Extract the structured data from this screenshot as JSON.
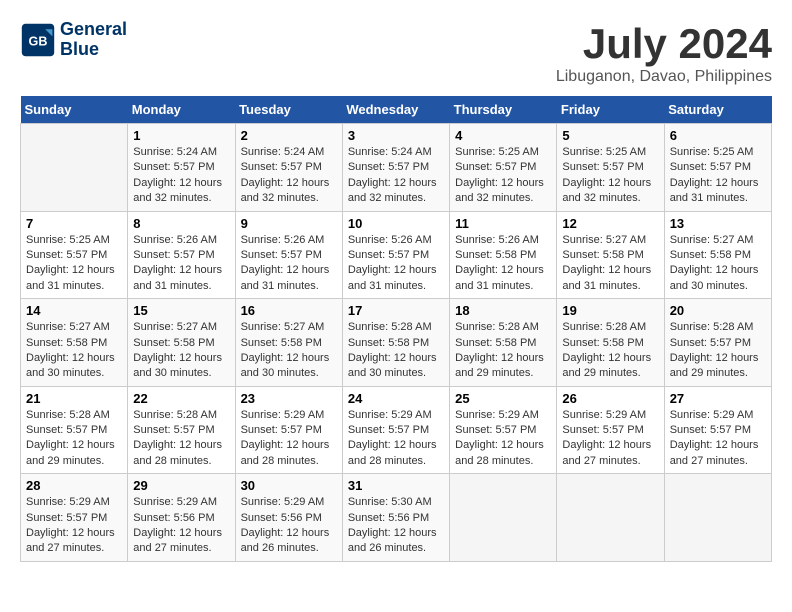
{
  "logo": {
    "line1": "General",
    "line2": "Blue"
  },
  "title": "July 2024",
  "subtitle": "Libuganon, Davao, Philippines",
  "header": {
    "days": [
      "Sunday",
      "Monday",
      "Tuesday",
      "Wednesday",
      "Thursday",
      "Friday",
      "Saturday"
    ]
  },
  "weeks": [
    {
      "cells": [
        {
          "day": "",
          "info": ""
        },
        {
          "day": "1",
          "info": "Sunrise: 5:24 AM\nSunset: 5:57 PM\nDaylight: 12 hours\nand 32 minutes."
        },
        {
          "day": "2",
          "info": "Sunrise: 5:24 AM\nSunset: 5:57 PM\nDaylight: 12 hours\nand 32 minutes."
        },
        {
          "day": "3",
          "info": "Sunrise: 5:24 AM\nSunset: 5:57 PM\nDaylight: 12 hours\nand 32 minutes."
        },
        {
          "day": "4",
          "info": "Sunrise: 5:25 AM\nSunset: 5:57 PM\nDaylight: 12 hours\nand 32 minutes."
        },
        {
          "day": "5",
          "info": "Sunrise: 5:25 AM\nSunset: 5:57 PM\nDaylight: 12 hours\nand 32 minutes."
        },
        {
          "day": "6",
          "info": "Sunrise: 5:25 AM\nSunset: 5:57 PM\nDaylight: 12 hours\nand 31 minutes."
        }
      ]
    },
    {
      "cells": [
        {
          "day": "7",
          "info": "Sunrise: 5:25 AM\nSunset: 5:57 PM\nDaylight: 12 hours\nand 31 minutes."
        },
        {
          "day": "8",
          "info": "Sunrise: 5:26 AM\nSunset: 5:57 PM\nDaylight: 12 hours\nand 31 minutes."
        },
        {
          "day": "9",
          "info": "Sunrise: 5:26 AM\nSunset: 5:57 PM\nDaylight: 12 hours\nand 31 minutes."
        },
        {
          "day": "10",
          "info": "Sunrise: 5:26 AM\nSunset: 5:57 PM\nDaylight: 12 hours\nand 31 minutes."
        },
        {
          "day": "11",
          "info": "Sunrise: 5:26 AM\nSunset: 5:58 PM\nDaylight: 12 hours\nand 31 minutes."
        },
        {
          "day": "12",
          "info": "Sunrise: 5:27 AM\nSunset: 5:58 PM\nDaylight: 12 hours\nand 31 minutes."
        },
        {
          "day": "13",
          "info": "Sunrise: 5:27 AM\nSunset: 5:58 PM\nDaylight: 12 hours\nand 30 minutes."
        }
      ]
    },
    {
      "cells": [
        {
          "day": "14",
          "info": "Sunrise: 5:27 AM\nSunset: 5:58 PM\nDaylight: 12 hours\nand 30 minutes."
        },
        {
          "day": "15",
          "info": "Sunrise: 5:27 AM\nSunset: 5:58 PM\nDaylight: 12 hours\nand 30 minutes."
        },
        {
          "day": "16",
          "info": "Sunrise: 5:27 AM\nSunset: 5:58 PM\nDaylight: 12 hours\nand 30 minutes."
        },
        {
          "day": "17",
          "info": "Sunrise: 5:28 AM\nSunset: 5:58 PM\nDaylight: 12 hours\nand 30 minutes."
        },
        {
          "day": "18",
          "info": "Sunrise: 5:28 AM\nSunset: 5:58 PM\nDaylight: 12 hours\nand 29 minutes."
        },
        {
          "day": "19",
          "info": "Sunrise: 5:28 AM\nSunset: 5:58 PM\nDaylight: 12 hours\nand 29 minutes."
        },
        {
          "day": "20",
          "info": "Sunrise: 5:28 AM\nSunset: 5:57 PM\nDaylight: 12 hours\nand 29 minutes."
        }
      ]
    },
    {
      "cells": [
        {
          "day": "21",
          "info": "Sunrise: 5:28 AM\nSunset: 5:57 PM\nDaylight: 12 hours\nand 29 minutes."
        },
        {
          "day": "22",
          "info": "Sunrise: 5:28 AM\nSunset: 5:57 PM\nDaylight: 12 hours\nand 28 minutes."
        },
        {
          "day": "23",
          "info": "Sunrise: 5:29 AM\nSunset: 5:57 PM\nDaylight: 12 hours\nand 28 minutes."
        },
        {
          "day": "24",
          "info": "Sunrise: 5:29 AM\nSunset: 5:57 PM\nDaylight: 12 hours\nand 28 minutes."
        },
        {
          "day": "25",
          "info": "Sunrise: 5:29 AM\nSunset: 5:57 PM\nDaylight: 12 hours\nand 28 minutes."
        },
        {
          "day": "26",
          "info": "Sunrise: 5:29 AM\nSunset: 5:57 PM\nDaylight: 12 hours\nand 27 minutes."
        },
        {
          "day": "27",
          "info": "Sunrise: 5:29 AM\nSunset: 5:57 PM\nDaylight: 12 hours\nand 27 minutes."
        }
      ]
    },
    {
      "cells": [
        {
          "day": "28",
          "info": "Sunrise: 5:29 AM\nSunset: 5:57 PM\nDaylight: 12 hours\nand 27 minutes."
        },
        {
          "day": "29",
          "info": "Sunrise: 5:29 AM\nSunset: 5:56 PM\nDaylight: 12 hours\nand 27 minutes."
        },
        {
          "day": "30",
          "info": "Sunrise: 5:29 AM\nSunset: 5:56 PM\nDaylight: 12 hours\nand 26 minutes."
        },
        {
          "day": "31",
          "info": "Sunrise: 5:30 AM\nSunset: 5:56 PM\nDaylight: 12 hours\nand 26 minutes."
        },
        {
          "day": "",
          "info": ""
        },
        {
          "day": "",
          "info": ""
        },
        {
          "day": "",
          "info": ""
        }
      ]
    }
  ]
}
